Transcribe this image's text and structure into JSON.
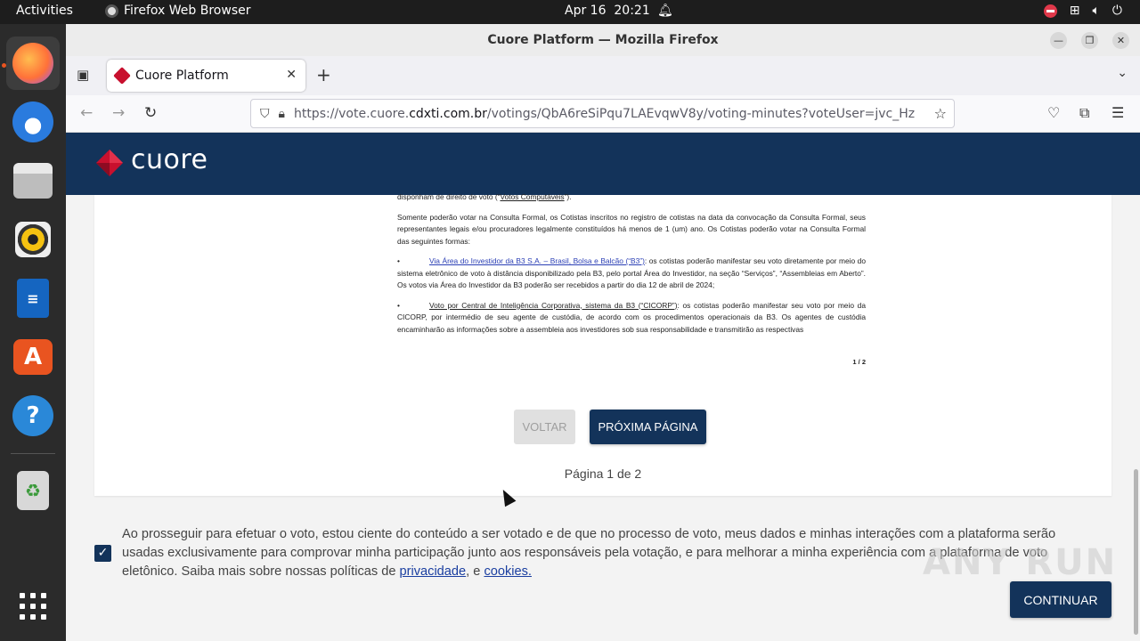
{
  "topbar": {
    "activities": "Activities",
    "app_name": "Firefox Web Browser",
    "date": "Apr 16",
    "time": "20:21"
  },
  "dock": {
    "items": [
      "firefox-icon",
      "thunderbird-icon",
      "files-icon",
      "rhythmbox-icon",
      "libreoffice-writer-icon",
      "app-center-icon",
      "help-icon",
      "trash-icon",
      "show-apps-icon"
    ]
  },
  "window": {
    "title": "Cuore Platform — Mozilla Firefox"
  },
  "tab": {
    "title": "Cuore Platform"
  },
  "urlbar": {
    "url_prefix": "https://vote.cuore.",
    "url_domain": "cdxti.com.br",
    "url_path": "/votings/QbA6reSiPqu7LAEvqwV8y/voting-minutes?voteUser=jvc_Hz"
  },
  "site": {
    "logo_text": "cuore",
    "brand_color": "#13335a",
    "accent_color": "#c8102e"
  },
  "document": {
    "p1_a": "disponham de direito de voto (“",
    "p1_link": "Votos Computáveis",
    "p1_b": "”).",
    "p2": "Somente poderão votar na Consulta Formal, os Cotistas inscritos no registro de cotistas na data da convocação da Consulta Formal, seus representantes legais e/ou procuradores legalmente constituídos há menos de 1 (um) ano. Os Cotistas poderão votar na Consulta Formal das seguintes formas:",
    "b1_link": "Via Área do Investidor da B3 S.A. – Brasil, Bolsa e Balcão (“B3”)",
    "b1_text": ": os cotistas poderão manifestar seu voto diretamente por meio do sistema eletrônico de voto à distância disponibilizado pela B3, pelo portal Área do Investidor, na seção “Serviços”, “Assembleias em Aberto”. Os votos via Área do Investidor da B3 poderão ser recebidos a partir do dia 12 de abril de 2024;",
    "b2_under": "Voto por Central de Inteligência Corporativa, sistema da B3 (“CICORP”)",
    "b2_text": ": os cotistas poderão manifestar seu voto por meio da CICORP, por intermédio de seu agente de custódia, de acordo com os procedimentos operacionais da B3. Os agentes de custódia encaminharão as informações sobre a assembleia aos investidores sob sua responsabilidade e transmitirão as respectivas",
    "page_marker": "1 / 2"
  },
  "pager": {
    "back_label": "VOLTAR",
    "next_label": "PRÓXIMA PÁGINA",
    "indicator": "Página 1 de 2"
  },
  "consent": {
    "checked": true,
    "text": "Ao prosseguir para efetuar o voto, estou ciente do conteúdo a ser votado e de que no processo de voto, meus dados e minhas interações com a plataforma serão usadas exclusivamente para comprovar minha participação junto aos responsáveis pela votação, e para melhorar a minha experiência com a plataforma de voto eletônico. Saiba mais sobre nossas políticas de ",
    "privacy_link": "privacidade",
    "sep": ", e ",
    "cookies_link": "cookies."
  },
  "actions": {
    "continue_label": "CONTINUAR"
  },
  "watermark": "ANY RUN"
}
